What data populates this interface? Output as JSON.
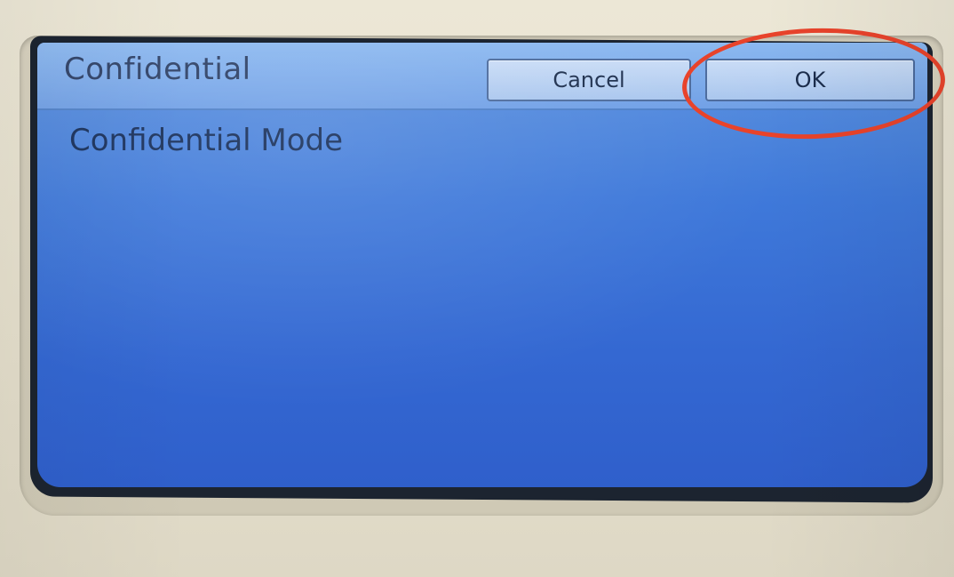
{
  "screen": {
    "title": "Confidential",
    "mode_label": "Confidential Mode"
  },
  "buttons": {
    "cancel_label": "Cancel",
    "ok_label": "OK"
  },
  "colors": {
    "screen_blue": "#3f79da",
    "header_blue": "#7aa8ea",
    "button_fill": "#b9d1f2",
    "highlight_ring": "#e8432b",
    "bezel": "#e7e2d2"
  }
}
